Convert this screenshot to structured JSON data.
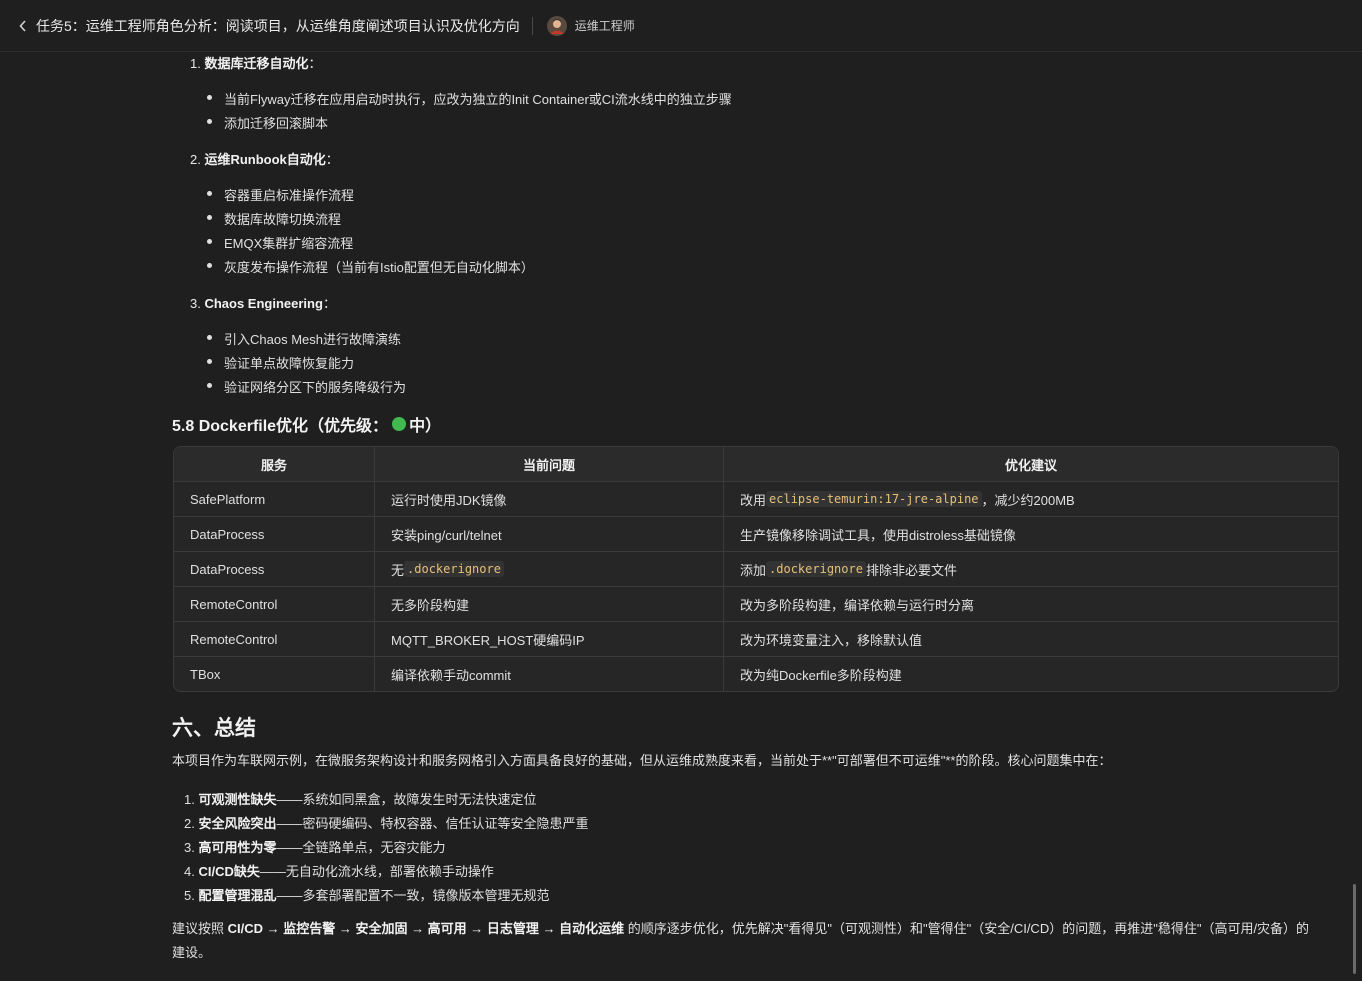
{
  "header": {
    "title": "任务5：运维工程师角色分析：阅读项目，从运维角度阐述项目认识及优化方向",
    "role": "运维工程师"
  },
  "sections": {
    "s1": {
      "num": "1.",
      "title": "数据库迁移自动化",
      "suffix": "：",
      "items": [
        "当前Flyway迁移在应用启动时执行，应改为独立的Init Container或CI流水线中的独立步骤",
        "添加迁移回滚脚本"
      ]
    },
    "s2": {
      "num": "2.",
      "title": "运维Runbook自动化",
      "suffix": "：",
      "items": [
        "容器重启标准操作流程",
        "数据库故障切换流程",
        "EMQX集群扩缩容流程",
        "灰度发布操作流程（当前有Istio配置但无自动化脚本）"
      ]
    },
    "s3": {
      "num": "3.",
      "title": "Chaos Engineering",
      "suffix": "：",
      "items": [
        "引入Chaos Mesh进行故障演练",
        "验证单点故障恢复能力",
        "验证网络分区下的服务降级行为"
      ]
    }
  },
  "dockerfile": {
    "heading": "5.8 Dockerfile优化（优先级：",
    "priority": "中）",
    "headers": [
      "服务",
      "当前问题",
      "优化建议"
    ],
    "rows": [
      {
        "service": "SafePlatform",
        "problem": "运行时使用JDK镜像",
        "s_pre": "改用",
        "s_code": "eclipse-temurin:17-jre-alpine",
        "s_post": "，减少约200MB"
      },
      {
        "service": "DataProcess",
        "problem": "安装ping/curl/telnet",
        "s_pre": "生产镜像移除调试工具，使用distroless基础镜像"
      },
      {
        "service": "DataProcess",
        "p_pre": "无 ",
        "p_code": ".dockerignore",
        "s_pre": "添加 ",
        "s_code": ".dockerignore",
        "s_post": "排除非必要文件"
      },
      {
        "service": "RemoteControl",
        "problem": "无多阶段构建",
        "s_pre": "改为多阶段构建，编译依赖与运行时分离"
      },
      {
        "service": "RemoteControl",
        "problem": "MQTT_BROKER_HOST硬编码IP",
        "s_pre": "改为环境变量注入，移除默认值"
      },
      {
        "service": "TBox",
        "problem": "编译依赖手动commit",
        "s_pre": "改为纯Dockerfile多阶段构建"
      }
    ]
  },
  "summary": {
    "heading": "六、总结",
    "intro": "本项目作为车联网示例，在微服务架构设计和服务网格引入方面具备良好的基础，但从运维成熟度来看，当前处于**\"可部署但不可运维\"**的阶段。核心问题集中在：",
    "items": [
      {
        "num": "1.",
        "bold": "可观测性缺失",
        "rest": "——系统如同黑盒，故障发生时无法快速定位"
      },
      {
        "num": "2.",
        "bold": "安全风险突出",
        "rest": "——密码硬编码、特权容器、信任认证等安全隐患严重"
      },
      {
        "num": "3.",
        "bold": "高可用性为零",
        "rest": "——全链路单点，无容灾能力"
      },
      {
        "num": "4.",
        "bold": "CI/CD缺失",
        "rest": "——无自动化流水线，部署依赖手动操作"
      },
      {
        "num": "5.",
        "bold": "配置管理混乱",
        "rest": "——多套部署配置不一致，镜像版本管理无规范"
      }
    ],
    "closing_pre": "建议按照 ",
    "closing_bold": "CI/CD → 监控告警 → 安全加固 → 高可用 → 日志管理 → 自动化运维",
    "closing_post": " 的顺序逐步优化，优先解决\"看得见\"（可观测性）和\"管得住\"（安全/CI/CD）的问题，再推进\"稳得住\"（高可用/灾备）的建设。"
  },
  "colors": {
    "background": "#1f1f1f",
    "priority_dot": "#3fb950",
    "code_text": "#e5c07b"
  }
}
